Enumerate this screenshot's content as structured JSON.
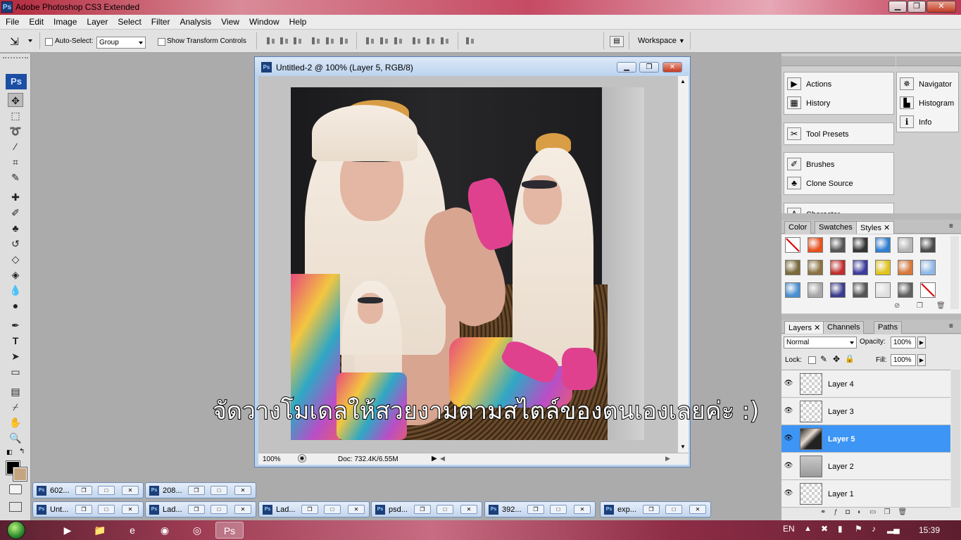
{
  "app": {
    "title": "Adobe Photoshop CS3 Extended",
    "logo": "Ps",
    "window_buttons": [
      "minimize-icon",
      "restore-icon",
      "close-icon"
    ]
  },
  "menu": [
    "File",
    "Edit",
    "Image",
    "Layer",
    "Select",
    "Filter",
    "Analysis",
    "View",
    "Window",
    "Help"
  ],
  "options": {
    "auto_select_label": "Auto-Select:",
    "auto_select_value": "Group",
    "show_transform_label": "Show Transform Controls",
    "workspace_label": "Workspace"
  },
  "toolbar": {
    "badge": "Ps",
    "tools": [
      "move-tool-icon",
      "marquee-tool-icon",
      "lasso-tool-icon",
      "magic-wand-icon",
      "crop-tool-icon",
      "slice-tool-icon",
      "healing-brush-icon",
      "brush-tool-icon",
      "clone-stamp-icon",
      "history-brush-icon",
      "eraser-icon",
      "paint-bucket-icon",
      "blur-tool-icon",
      "dodge-tool-icon",
      "pen-tool-icon",
      "type-tool-icon",
      "path-selection-icon",
      "shape-tool-icon",
      "notes-tool-icon",
      "eyedropper-icon",
      "hand-tool-icon",
      "zoom-tool-icon"
    ],
    "foreground_color": "#000000",
    "background_color": "#c5a47f"
  },
  "document": {
    "title": "Untitled-2 @ 100% (Layer 5, RGB/8)",
    "zoom": "100%",
    "doc_info": "Doc: 732.4K/6.55M",
    "caption": "จัดวางโมเดลให้สวยงามตามสไตล์ของตนเองเลยค่ะ :)"
  },
  "minimized_docs": {
    "row1": [
      {
        "name": "602..."
      },
      {
        "name": "208..."
      }
    ],
    "row2": [
      {
        "name": "Unt..."
      },
      {
        "name": "Lad..."
      },
      {
        "name": "Lad..."
      },
      {
        "name": "psd..."
      },
      {
        "name": "392..."
      },
      {
        "name": "exp..."
      }
    ]
  },
  "panels": {
    "col_a": [
      "Actions",
      "History",
      "Tool Presets",
      "Brushes",
      "Clone Source",
      "Character"
    ],
    "col_b": [
      "Navigator",
      "Histogram",
      "Info"
    ],
    "style_tabs": [
      "Color",
      "Swatches",
      "Styles"
    ],
    "layer_tabs": [
      "Layers",
      "Channels",
      "Paths"
    ],
    "blend_mode": "Normal",
    "opacity_label": "Opacity:",
    "opacity_value": "100%",
    "lock_label": "Lock:",
    "fill_label": "Fill:",
    "fill_value": "100%",
    "layers": [
      {
        "name": "Layer 4",
        "selected": false
      },
      {
        "name": "Layer 3",
        "selected": false
      },
      {
        "name": "Layer 5",
        "selected": true
      },
      {
        "name": "Layer 2",
        "selected": false
      },
      {
        "name": "Layer 1",
        "selected": false
      }
    ],
    "style_colors": [
      "#ffffff",
      "#e8511c",
      "#555555",
      "#333333",
      "#2f7fd1",
      "#b5b5b5",
      "#4a4a4a",
      "#7a6a3a",
      "#8b7340",
      "#c22d2d",
      "#3b3b9e",
      "#e1c31c",
      "#d7783a",
      "#8fb8e8",
      "#4a8fd0",
      "#a8a8a8",
      "#3b3b8f",
      "#555555",
      "#e0e0e0",
      "#606060",
      "#ffffff"
    ]
  },
  "taskbar": {
    "lang": "EN",
    "time": "15:39"
  }
}
